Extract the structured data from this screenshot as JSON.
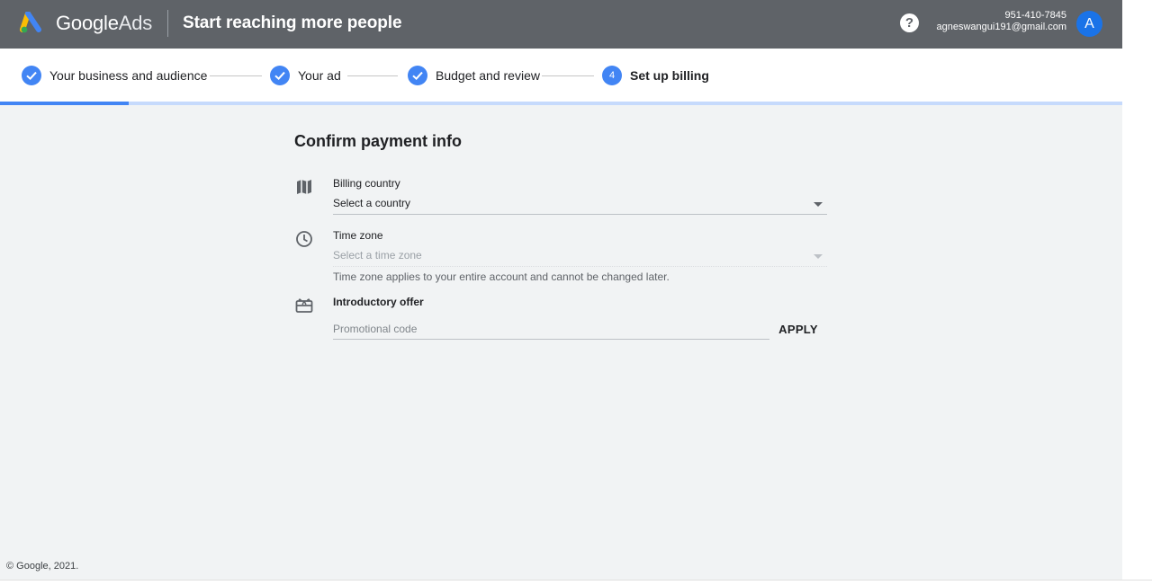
{
  "header": {
    "brand_google": "Google",
    "brand_ads": "Ads",
    "title": "Start reaching more people",
    "help_label": "?",
    "phone": "951-410-7845",
    "email": "agneswangui191@gmail.com",
    "avatar_initial": "A"
  },
  "stepper": {
    "steps": [
      {
        "label": "Your business and audience",
        "state": "done"
      },
      {
        "label": "Your ad",
        "state": "done"
      },
      {
        "label": "Budget and review",
        "state": "done"
      },
      {
        "label": "Set up billing",
        "state": "current",
        "number": "4"
      }
    ],
    "progress_fraction": 0.115
  },
  "payment": {
    "title": "Confirm payment info",
    "billing_country": {
      "label": "Billing country",
      "value": "Select a country",
      "icon": "map-icon"
    },
    "time_zone": {
      "label": "Time zone",
      "value": "Select a time zone",
      "hint": "Time zone applies to your entire account and cannot be changed later.",
      "icon": "clock-icon"
    },
    "intro_offer": {
      "label": "Introductory offer",
      "placeholder": "Promotional code",
      "apply_label": "APPLY",
      "icon": "gift-card-icon"
    }
  },
  "footer": {
    "copyright": "© Google, 2021."
  },
  "colors": {
    "header_bg": "#5f6368",
    "accent": "#4285f4",
    "page_bg": "#f1f3f4"
  }
}
